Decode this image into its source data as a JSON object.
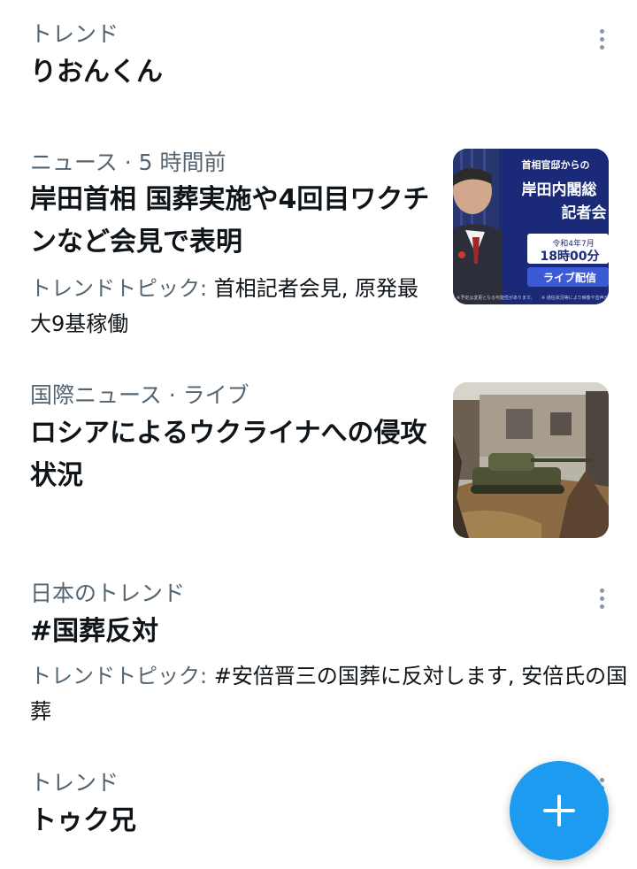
{
  "trends": [
    {
      "category": "トレンド",
      "title": "りおんくん"
    },
    {
      "category": "ニュース",
      "separator": "·",
      "time": "5 時間前",
      "title": "岸田首相 国葬実施や4回目ワクチンなど会見で表明",
      "topic_label": "トレンドトピック:",
      "topic_text": " 首相記者会見, 原発最大9基稼働",
      "thumbnail": {
        "headline": "首相官邸からの",
        "main": "岸田内閣総",
        "main2": "記者会",
        "date": "令和4年7月",
        "time": "18時00分",
        "cta": "ライブ配信",
        "footer": "※ 通信状況等により映像や音声が",
        "footer_left": "※予定は変更となる可能性があります。"
      }
    },
    {
      "category": "国際ニュース",
      "separator": "·",
      "time": "ライブ",
      "title": "ロシアによるウクライナへの侵攻状況"
    },
    {
      "category": "日本のトレンド",
      "title": "#国葬反対",
      "topic_label": "トレンドトピック:",
      "topic_text": " #安倍晋三の国葬に反対します, 安倍氏の国葬"
    },
    {
      "category": "トレンド",
      "title": "トゥク兄"
    }
  ],
  "fab": {
    "icon": "plus-icon",
    "color": "#1d9bf0"
  },
  "colors": {
    "text_primary": "#0f1419",
    "text_secondary": "#536471",
    "accent": "#1d9bf0"
  }
}
